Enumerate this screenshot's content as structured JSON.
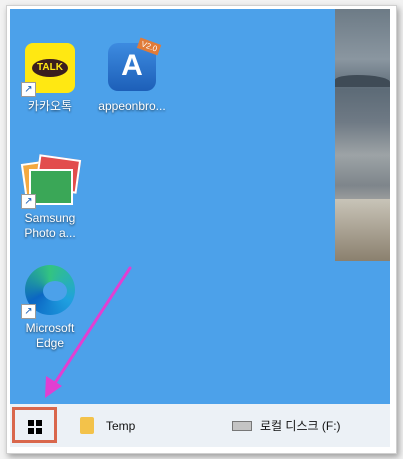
{
  "desktop": {
    "icons": [
      {
        "label": "카카오톡",
        "icon": "kakaotalk-icon",
        "badge": "TALK"
      },
      {
        "label": "appeonbro...",
        "icon": "appeon-icon",
        "badge": "V2.0"
      },
      {
        "label_line1": "Samsung",
        "label_line2": "Photo a...",
        "icon": "samsung-photo-icon"
      },
      {
        "label_line1": "Microsoft",
        "label_line2": "Edge",
        "icon": "edge-icon"
      }
    ],
    "shortcut_glyph": "↗"
  },
  "taskbar": {
    "items": [
      {
        "label": "Temp",
        "icon": "folder-icon"
      },
      {
        "label": "로컬 디스크 (F:)",
        "icon": "drive-icon"
      }
    ]
  },
  "colors": {
    "desktop": "#4ca1ea",
    "highlight": "#d9674c",
    "arrow": "#e13fd2"
  }
}
